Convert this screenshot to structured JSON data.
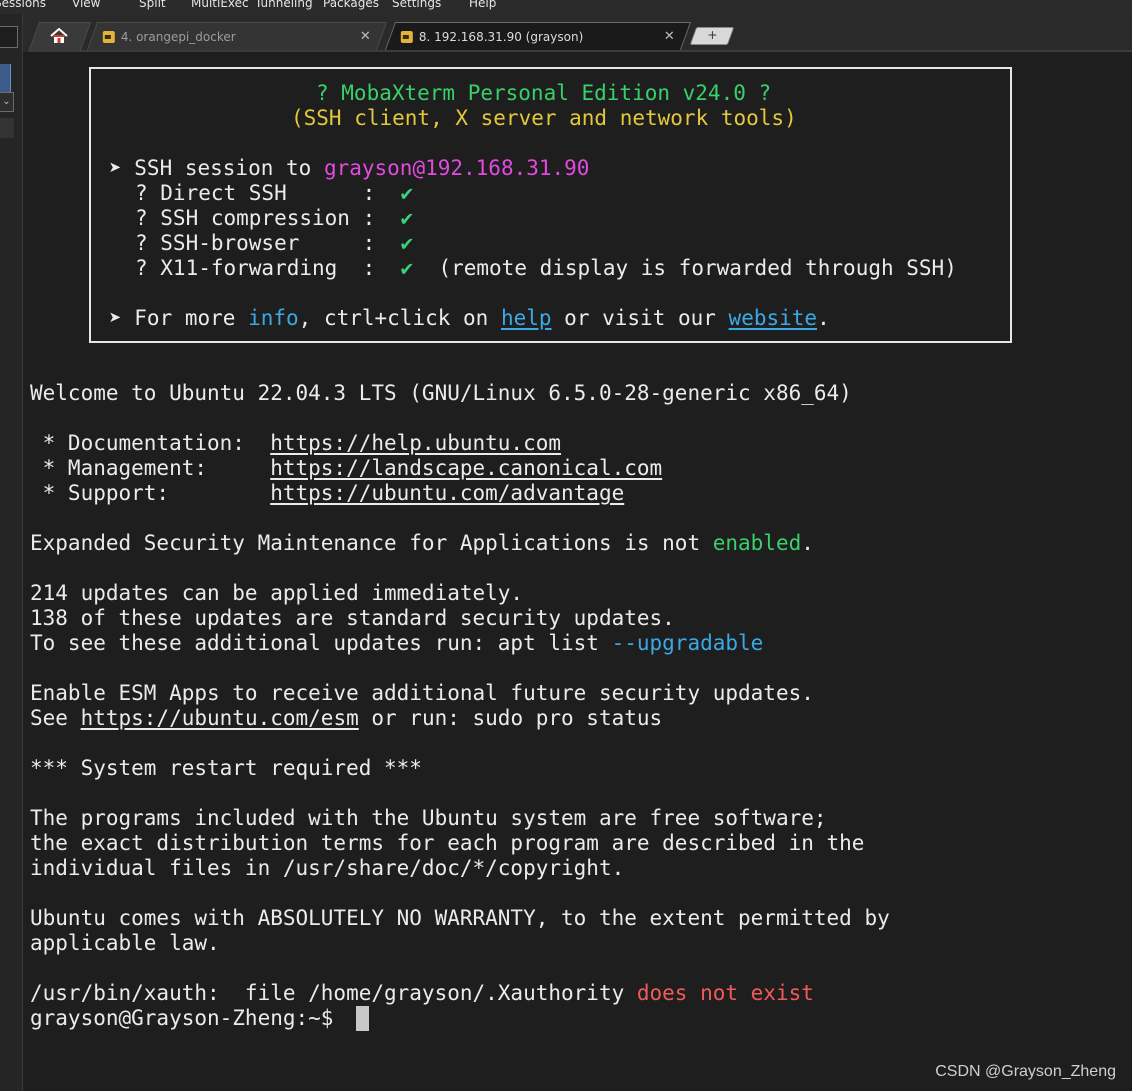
{
  "menu": {
    "items": [
      "Sessions",
      "View",
      "Split",
      "MultiExec",
      "Tunneling",
      "Packages",
      "Settings",
      "Help"
    ]
  },
  "tabs": {
    "tab1_label": "4. orangepi_docker",
    "tab2_label": "8. 192.168.31.90 (grayson)",
    "close_glyph": "✕",
    "new_tab_glyph": "+"
  },
  "banner": {
    "title": "? MobaXterm Personal Edition v24.0 ?",
    "subtitle": "(SSH client, X server and network tools)",
    "session_prefix": "➤ SSH session to ",
    "session_target": "grayson@192.168.31.90",
    "features": [
      {
        "label": "? Direct SSH      :",
        "check": "✔",
        "note": ""
      },
      {
        "label": "? SSH compression :",
        "check": "✔",
        "note": ""
      },
      {
        "label": "? SSH-browser     :",
        "check": "✔",
        "note": ""
      },
      {
        "label": "? X11-forwarding  :",
        "check": "✔",
        "note": "(remote display is forwarded through SSH)"
      }
    ],
    "more_prefix": "➤ For more ",
    "more_info": "info",
    "more_mid": ", ctrl+click on ",
    "more_help": "help",
    "more_mid2": " or visit our ",
    "more_website": "website",
    "more_end": "."
  },
  "terminal": {
    "welcome": "Welcome to Ubuntu 22.04.3 LTS (GNU/Linux 6.5.0-28-generic x86_64)",
    "doc_label": " * Documentation:  ",
    "doc_url": "https://help.ubuntu.com",
    "mgmt_label": " * Management:     ",
    "mgmt_url": "https://landscape.canonical.com",
    "support_label": " * Support:        ",
    "support_url": "https://ubuntu.com/advantage",
    "esm_prefix": "Expanded Security Maintenance for Applications is not ",
    "esm_enabled": "enabled",
    "esm_end": ".",
    "updates_1": "214 updates can be applied immediately.",
    "updates_2": "138 of these updates are standard security updates.",
    "updates_3_prefix": "To see these additional updates run: apt list ",
    "updates_3_flag": "--upgradable",
    "esm_apps_1": "Enable ESM Apps to receive additional future security updates.",
    "esm_apps_2_prefix": "See ",
    "esm_apps_2_url": "https://ubuntu.com/esm",
    "esm_apps_2_suffix": " or run: sudo pro status",
    "restart": "*** System restart required ***",
    "free_1": "The programs included with the Ubuntu system are free software;",
    "free_2": "the exact distribution terms for each program are described in the",
    "free_3": "individual files in /usr/share/doc/*/copyright.",
    "warranty_1": "Ubuntu comes with ABSOLUTELY NO WARRANTY, to the extent permitted by",
    "warranty_2": "applicable law.",
    "xauth_prefix": "/usr/bin/xauth:  file /home/grayson/.Xauthority ",
    "xauth_error": "does not exist",
    "prompt": "grayson@Grayson-Zheng:~$ "
  },
  "watermark": "CSDN @Grayson_Zheng"
}
